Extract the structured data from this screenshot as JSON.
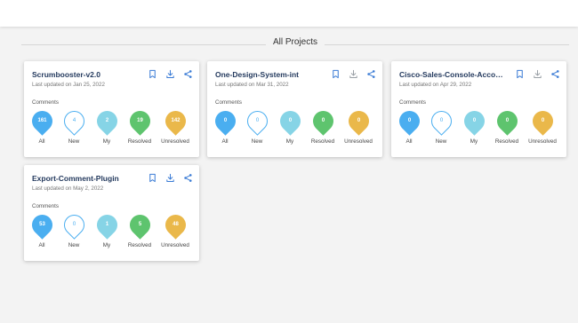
{
  "page": {
    "section_title": "All Projects"
  },
  "colors": {
    "all": "#4aaef0",
    "new": "#4aaef0",
    "my": "#86d4e6",
    "resolved": "#5ec46e",
    "unresolved": "#eab84a",
    "icon": "#3a7bd5",
    "icon_muted": "#9aa0a6"
  },
  "cards": [
    {
      "title": "Scrumbooster-v2.0",
      "updated": "Last updated on Jan 25, 2022",
      "comments_label": "Comments",
      "download_active": true,
      "stats": [
        {
          "value": "161",
          "label": "All",
          "kind": "all"
        },
        {
          "value": "4",
          "label": "New",
          "kind": "new"
        },
        {
          "value": "2",
          "label": "My",
          "kind": "my"
        },
        {
          "value": "19",
          "label": "Resolved",
          "kind": "resolved"
        },
        {
          "value": "142",
          "label": "Unresolved",
          "kind": "unresolved"
        }
      ]
    },
    {
      "title": "One-Design-System-int",
      "updated": "Last updated on Mar 31, 2022",
      "comments_label": "Comments",
      "download_active": false,
      "stats": [
        {
          "value": "0",
          "label": "All",
          "kind": "all"
        },
        {
          "value": "0",
          "label": "New",
          "kind": "new"
        },
        {
          "value": "0",
          "label": "My",
          "kind": "my"
        },
        {
          "value": "0",
          "label": "Resolved",
          "kind": "resolved"
        },
        {
          "value": "0",
          "label": "Unresolved",
          "kind": "unresolved"
        }
      ]
    },
    {
      "title": "Cisco-Sales-Console-Account-I...",
      "updated": "Last updated on Apr 29, 2022",
      "comments_label": "Comments",
      "download_active": false,
      "stats": [
        {
          "value": "0",
          "label": "All",
          "kind": "all"
        },
        {
          "value": "0",
          "label": "New",
          "kind": "new"
        },
        {
          "value": "0",
          "label": "My",
          "kind": "my"
        },
        {
          "value": "0",
          "label": "Resolved",
          "kind": "resolved"
        },
        {
          "value": "0",
          "label": "Unresolved",
          "kind": "unresolved"
        }
      ]
    },
    {
      "title": "Export-Comment-Plugin",
      "updated": "Last updated on May 2, 2022",
      "comments_label": "Comments",
      "download_active": true,
      "stats": [
        {
          "value": "53",
          "label": "All",
          "kind": "all"
        },
        {
          "value": "0",
          "label": "New",
          "kind": "new"
        },
        {
          "value": "1",
          "label": "My",
          "kind": "my"
        },
        {
          "value": "5",
          "label": "Resolved",
          "kind": "resolved"
        },
        {
          "value": "48",
          "label": "Unresolved",
          "kind": "unresolved"
        }
      ]
    }
  ]
}
